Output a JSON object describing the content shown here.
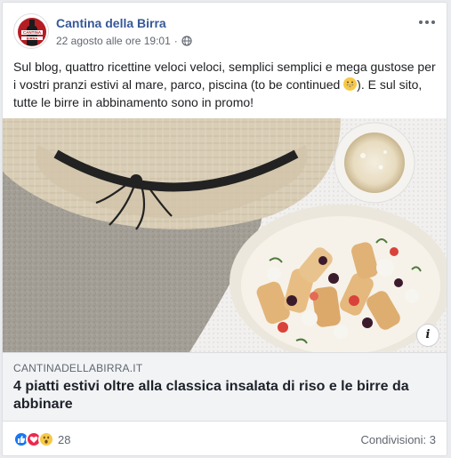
{
  "post": {
    "page_name": "Cantina della Birra",
    "timestamp": "22 agosto alle ore 19:01",
    "separator": "·",
    "privacy_icon": "globe-icon",
    "more_icon": "more-horizontal-icon",
    "text_before_emoji": "Sul blog, quattro ricettine veloci veloci, semplici semplici e mega gustose per i vostri pranzi estivi al mare, parco, piscina (to be continued ",
    "text_after_emoji": "). E sul sito, tutte le birre in abbinamento sono in promo!",
    "emoji_icon": "grinning-face-emoji",
    "avatar_text_top": "CANTINA",
    "avatar_text_bottom": "BIRRA"
  },
  "link": {
    "domain": "CANTINADELLABIRRA.IT",
    "title": "4 piatti estivi oltre alla classica insalata di riso e le birre da abbinare",
    "info_label": "i"
  },
  "footer": {
    "reaction_icons": [
      "like-icon",
      "love-icon",
      "wow-icon"
    ],
    "reaction_count": "28",
    "shares": "Condivisioni: 3"
  },
  "colors": {
    "page_name": "#365899",
    "like": "#1877f2",
    "love": "#f0284a",
    "wow": "#f7c948",
    "link_bg": "#f2f3f5"
  }
}
